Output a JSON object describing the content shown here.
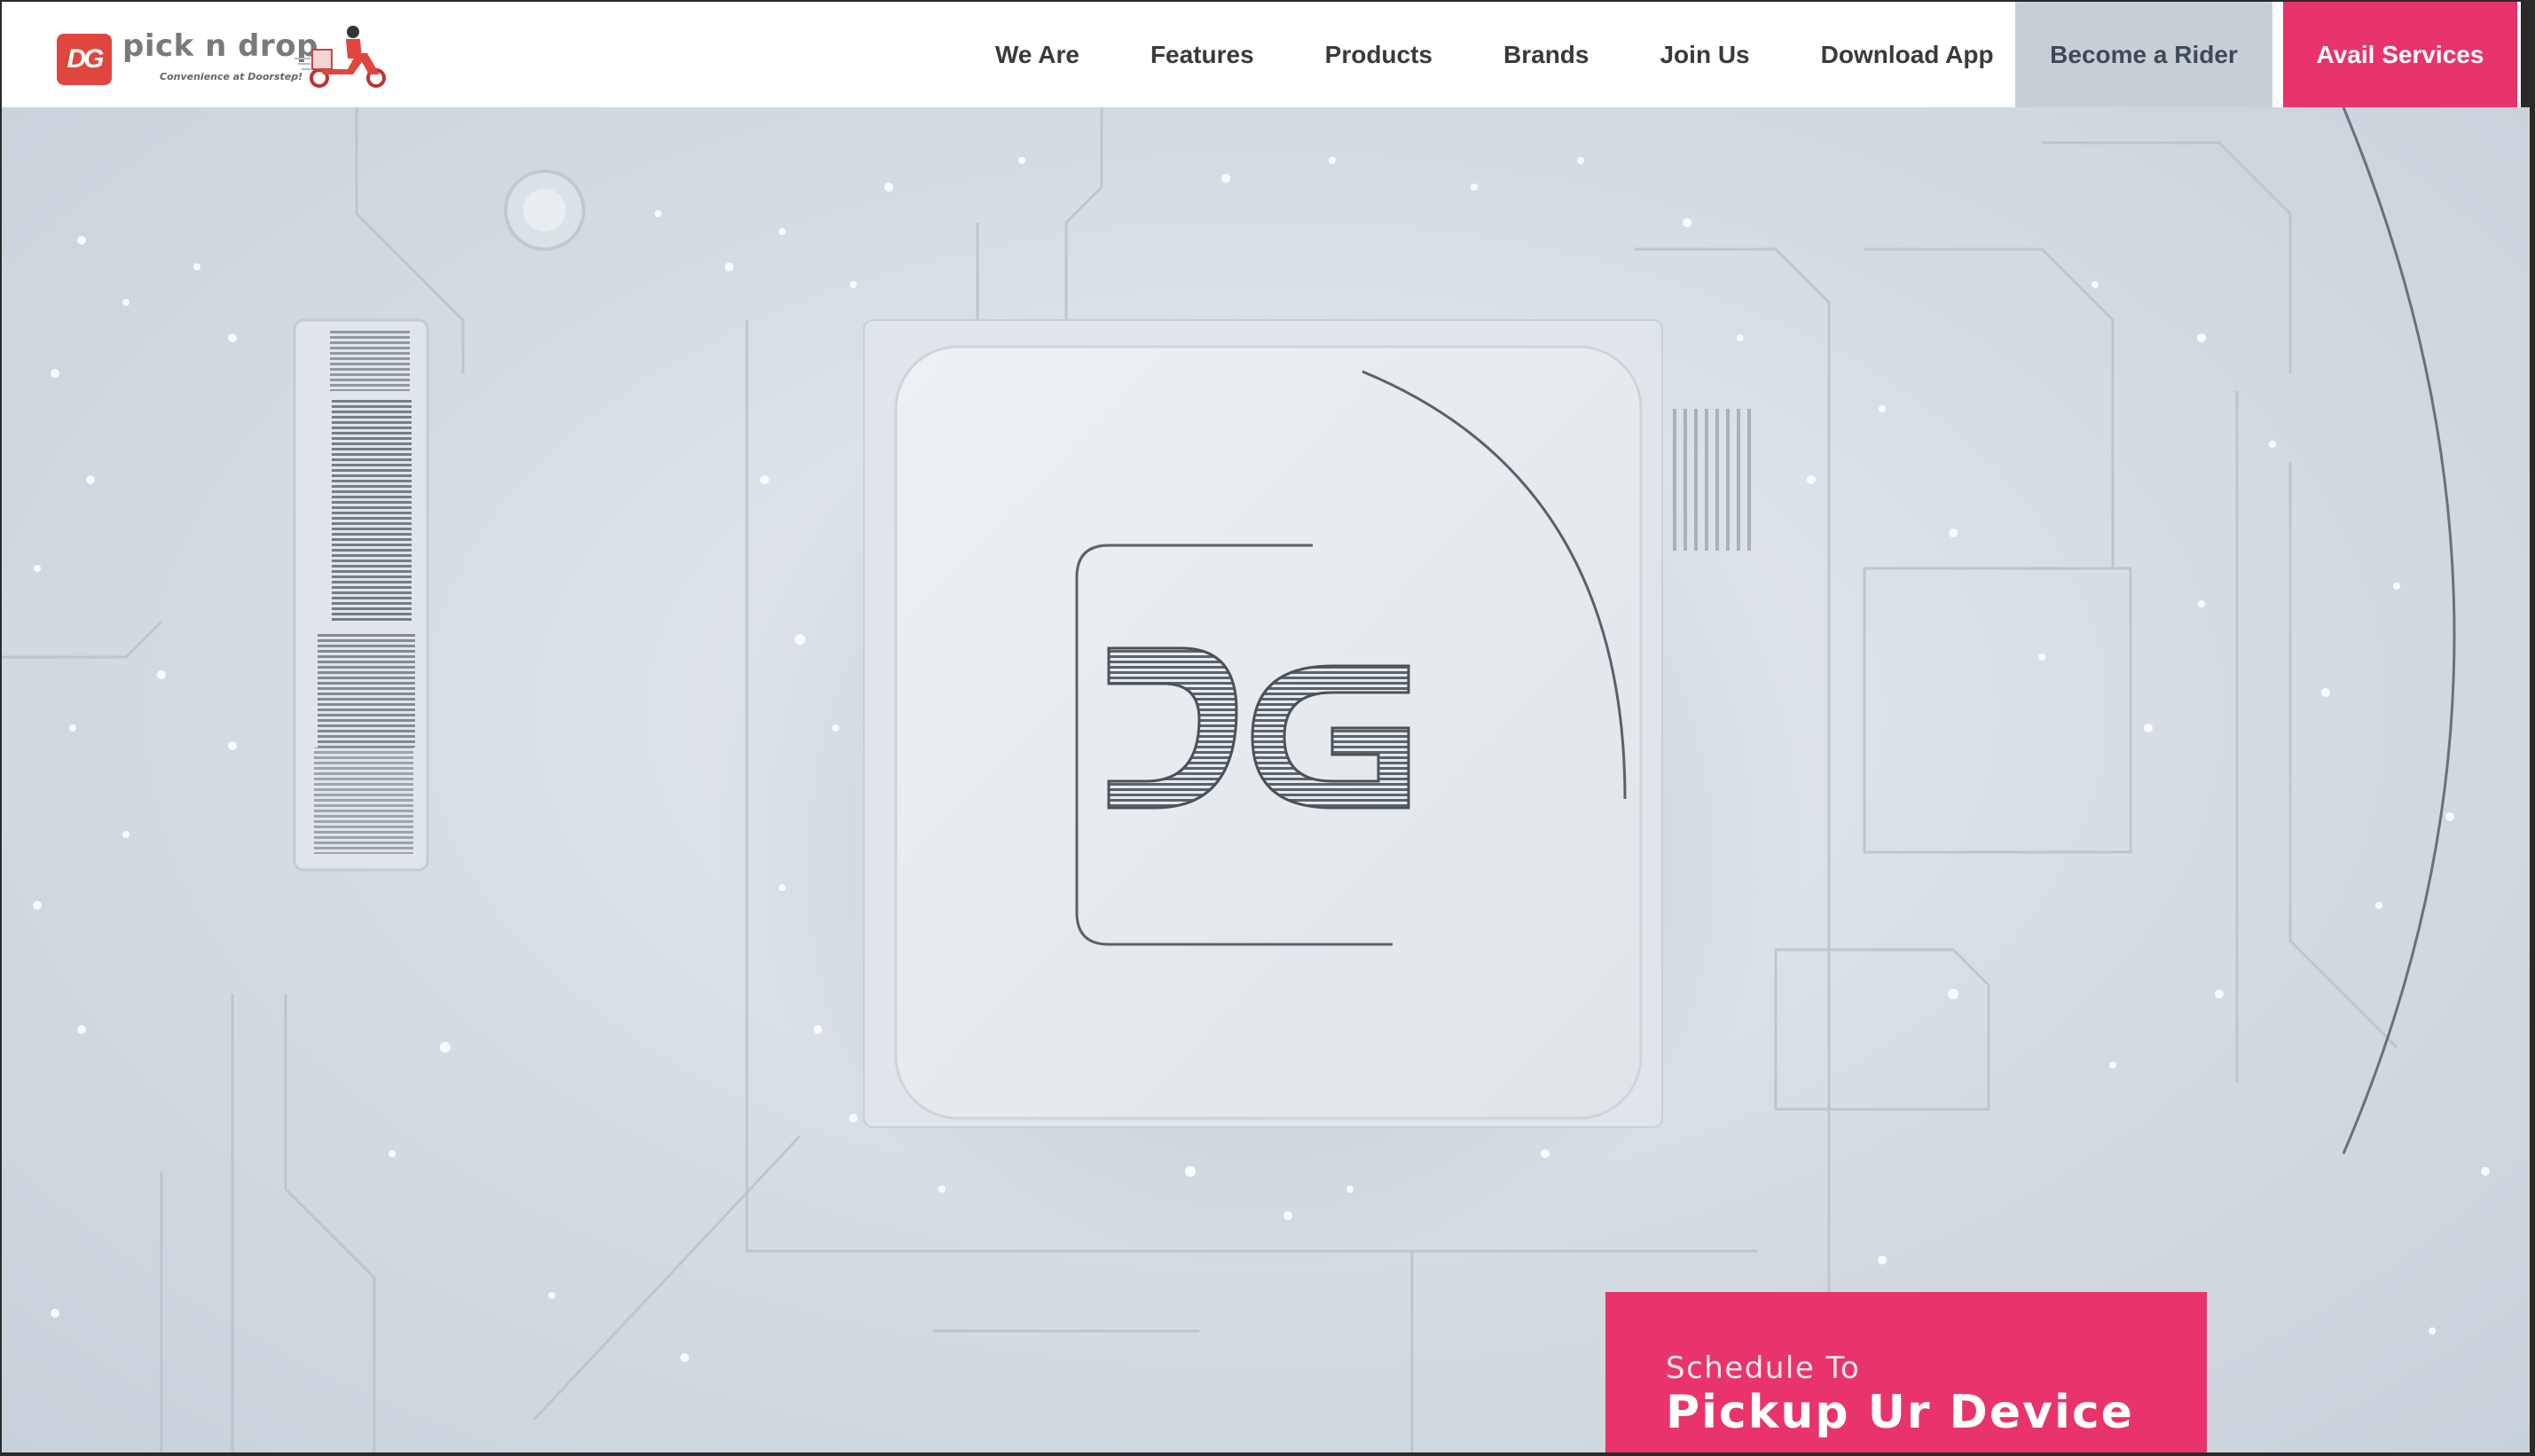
{
  "brand": {
    "name": "pick n drop",
    "tagline": "Convenience at Doorstep!",
    "logo_mark": "DG",
    "accent_color": "#e9336b",
    "logo_color": "#e0463e"
  },
  "nav": {
    "links": [
      {
        "label": "We Are"
      },
      {
        "label": "Features"
      },
      {
        "label": "Products"
      },
      {
        "label": "Brands"
      },
      {
        "label": "Join Us"
      },
      {
        "label": "Download App"
      }
    ],
    "become_rider_label": "Become a Rider",
    "avail_services_label": "Avail Services"
  },
  "hero": {
    "chip_logo": "DG",
    "cta": {
      "line1": "Schedule To",
      "line2": "Pickup Ur Device"
    }
  },
  "icons": [
    "scooter-rider-icon"
  ]
}
